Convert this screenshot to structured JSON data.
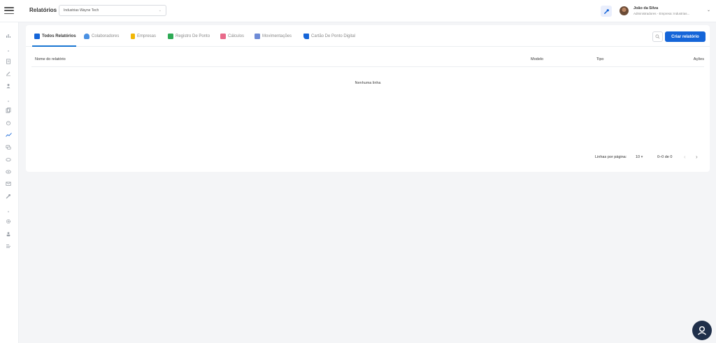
{
  "header": {
    "title": "Relatórios",
    "company_select": {
      "value": "Industrias Wayne Tech"
    },
    "user": {
      "name": "João da Silva",
      "role": "Administradores - Empresa: Industrias..."
    }
  },
  "sidebar": {
    "icons": [
      "chart-icon",
      "document-icon",
      "pen-icon",
      "user-icon",
      "files-icon",
      "alarm-icon",
      "trend-icon",
      "chat-icon",
      "cloud-icon",
      "eye-icon",
      "mail-icon",
      "wrench-icon",
      "gear-icon",
      "person-icon",
      "list-icon"
    ],
    "active_icon": "trend-icon"
  },
  "tabs": [
    {
      "label": "Todos Relatórios",
      "icon": "grid-icon",
      "color": "#1565d8"
    },
    {
      "label": "Colaboradores",
      "icon": "users-icon",
      "color": "#4a90e2"
    },
    {
      "label": "Empresas",
      "icon": "building-icon",
      "color": "#f2b705"
    },
    {
      "label": "Registro De Ponto",
      "icon": "clock-icon",
      "color": "#2eaa55"
    },
    {
      "label": "Cálculos",
      "icon": "calculator-icon",
      "color": "#e86a8a"
    },
    {
      "label": "Movimentações",
      "icon": "move-icon",
      "color": "#6e8bd6"
    },
    {
      "label": "Cartão De Ponto Digital",
      "icon": "card-edit-icon",
      "color": "#1565d8"
    }
  ],
  "actions": {
    "create_label": "Criar relatório"
  },
  "table": {
    "columns": [
      "Nome do relatório",
      "Modelo",
      "Tipo",
      "Ações"
    ],
    "empty_text": "Nenhuma linha"
  },
  "pagination": {
    "rows_per_page_label": "Linhas por página:",
    "rows_per_page_value": "10",
    "range": "0–0 de 0"
  },
  "colors": {
    "accent": "#1565d8",
    "fab": "#1f2f4a"
  }
}
